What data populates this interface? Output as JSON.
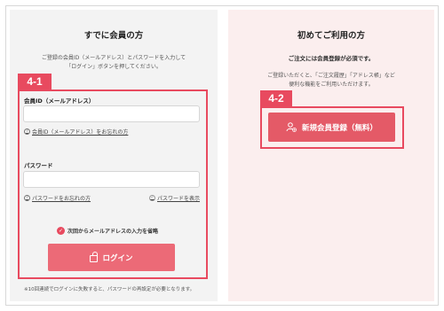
{
  "left": {
    "title": "すでに会員の方",
    "desc_line1": "ご登録の会員ID（メールアドレス）とパスワードを入力して",
    "desc_line2": "「ログイン」ボタンを押してください。",
    "tag": "4-1",
    "member_id_label": "会員ID（メールアドレス）",
    "member_id_value": "",
    "forgot_id_link": "会員ID（メールアドレス）をお忘れの方",
    "password_label": "パスワード",
    "password_value": "",
    "forgot_password_link": "パスワードをお忘れの方",
    "show_password_link": "パスワードを表示",
    "remember_label": "次回からメールアドレスの入力を省略",
    "login_button": "ログイン",
    "note": "※10回連続でログインに失敗すると、パスワードの再設定が必要となります。"
  },
  "right": {
    "title": "初めてご利用の方",
    "subtitle": "ご注文には会員登録が必須です。",
    "desc_line1": "ご登録いただくと、「ご注文履歴」「アドレス帳」など",
    "desc_line2": "便利な機能をご利用いただけます。",
    "tag": "4-2",
    "register_button": "新規会員登録（無料）"
  },
  "colors": {
    "accent": "#e84a5f",
    "button": "#ec6a77",
    "right_bg": "#fbeeee"
  },
  "icons": {
    "help": "question-circle-icon",
    "eye": "check-circle-icon",
    "lock": "lock-icon",
    "user_add": "user-add-icon"
  }
}
